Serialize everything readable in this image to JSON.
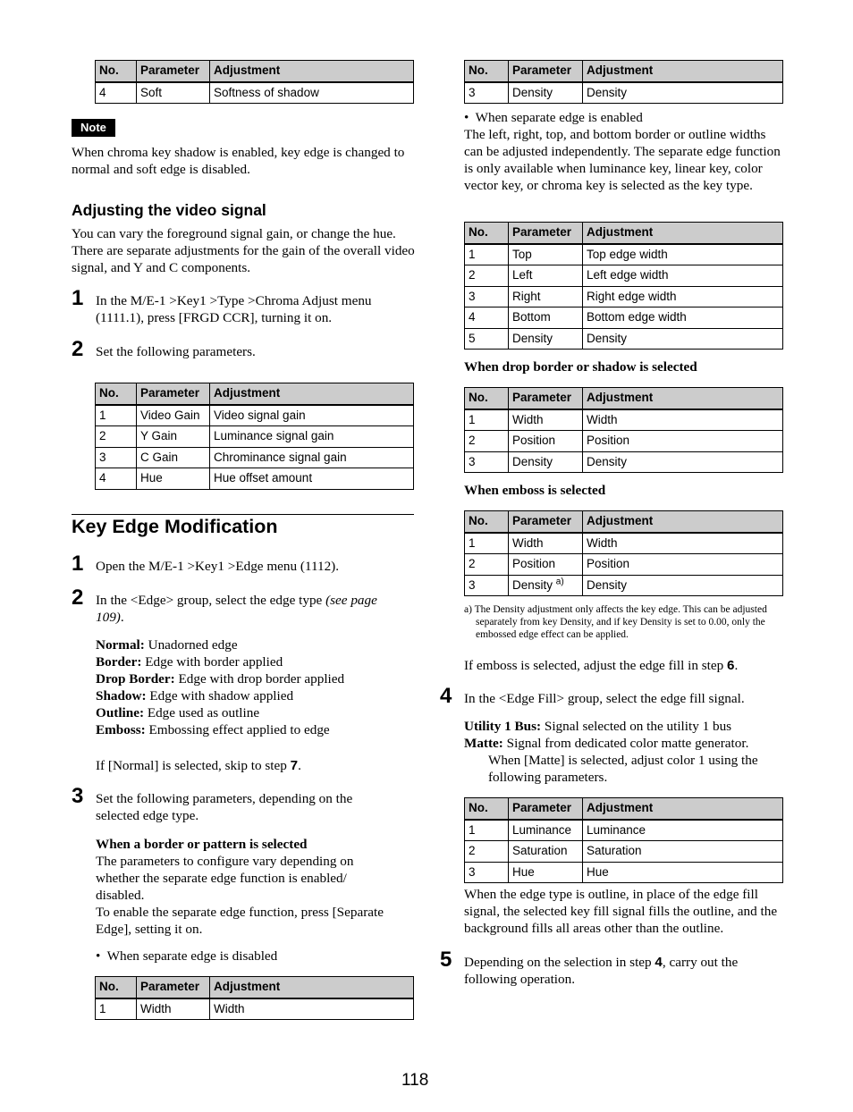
{
  "table_header": {
    "no": "No.",
    "parameter": "Parameter",
    "adjustment": "Adjustment"
  },
  "left": {
    "shadow_table": [
      {
        "no": "4",
        "parameter": "Soft",
        "adjustment": "Softness of shadow"
      }
    ],
    "note_label": "Note",
    "note_text": "When chroma key shadow is enabled, key edge is changed to normal and soft edge is disabled.",
    "video_signal": {
      "heading": "Adjusting the video signal",
      "intro": "You can vary the foreground signal gain, or change the hue. There are separate adjustments for the gain of the overall video signal, and Y and C components.",
      "step1_num": "1",
      "step1_text": "In the M/E-1 >Key1 >Type >Chroma Adjust menu (1111.1), press [FRGD CCR], turning it on.",
      "step2_num": "2",
      "step2_text": "Set the following parameters.",
      "table": [
        {
          "no": "1",
          "parameter": "Video Gain",
          "adjustment": "Video signal gain"
        },
        {
          "no": "2",
          "parameter": "Y Gain",
          "adjustment": "Luminance signal gain"
        },
        {
          "no": "3",
          "parameter": "C Gain",
          "adjustment": "Chrominance signal gain"
        },
        {
          "no": "4",
          "parameter": "Hue",
          "adjustment": "Hue offset amount"
        }
      ]
    },
    "key_edge": {
      "title": "Key Edge Modification",
      "step1_num": "1",
      "step1_text": "Open the M/E-1 >Key1 >Edge menu (1112).",
      "step2_num": "2",
      "step2_text_a": "In the <Edge> group, select the edge type ",
      "step2_text_ref": "(see page 109)",
      "step2_text_b": ".",
      "edge_types": [
        {
          "term": "Normal:",
          "desc": " Unadorned edge"
        },
        {
          "term": "Border:",
          "desc": " Edge with border applied"
        },
        {
          "term": "Drop Border:",
          "desc": " Edge with drop border applied"
        },
        {
          "term": "Shadow:",
          "desc": " Edge with shadow applied"
        },
        {
          "term": "Outline:",
          "desc": " Edge used as outline"
        },
        {
          "term": "Emboss:",
          "desc": " Embossing effect applied to edge"
        }
      ],
      "skip_text_a": "If [Normal] is selected, skip to step ",
      "skip_step": "7",
      "skip_text_b": ".",
      "step3_num": "3",
      "step3_text": "Set the following parameters, depending on the selected edge type.",
      "border_heading": "When a border or pattern is selected",
      "border_text1": "The parameters to configure vary depending on whether the separate edge function is enabled/ disabled.",
      "border_text2": "To enable the separate edge function, press [Separate Edge], setting it on.",
      "bullet_disabled": "When separate edge is disabled",
      "disabled_table": [
        {
          "no": "1",
          "parameter": "Width",
          "adjustment": "Width"
        }
      ]
    }
  },
  "right": {
    "density_table": [
      {
        "no": "3",
        "parameter": "Density",
        "adjustment": "Density"
      }
    ],
    "bullet_enabled": "When separate edge is enabled",
    "enabled_text": "The left, right, top, and bottom border or outline widths can be adjusted independently. The separate edge function is only available when luminance key, linear key, color vector key, or chroma key is selected as the key type.",
    "enabled_table": [
      {
        "no": "1",
        "parameter": "Top",
        "adjustment": "Top edge width"
      },
      {
        "no": "2",
        "parameter": "Left",
        "adjustment": "Left edge width"
      },
      {
        "no": "3",
        "parameter": "Right",
        "adjustment": "Right edge width"
      },
      {
        "no": "4",
        "parameter": "Bottom",
        "adjustment": "Bottom edge width"
      },
      {
        "no": "5",
        "parameter": "Density",
        "adjustment": "Density"
      }
    ],
    "drop_heading": "When drop border or shadow is selected",
    "drop_table": [
      {
        "no": "1",
        "parameter": "Width",
        "adjustment": "Width"
      },
      {
        "no": "2",
        "parameter": "Position",
        "adjustment": "Position"
      },
      {
        "no": "3",
        "parameter": "Density",
        "adjustment": "Density"
      }
    ],
    "emboss_heading": "When emboss is selected",
    "emboss_table": [
      {
        "no": "1",
        "parameter": "Width",
        "adjustment": "Width"
      },
      {
        "no": "2",
        "parameter": "Position",
        "adjustment": "Position"
      },
      {
        "no": "3",
        "parameter": "Density",
        "sup": "a)",
        "adjustment": "Density"
      }
    ],
    "footnote": "a) The Density adjustment only affects the key edge. This can be adjusted separately from key Density, and if key Density is set to 0.00, only the embossed edge effect can be applied.",
    "emboss_note_a": "If emboss is selected, adjust the edge fill in step ",
    "emboss_note_step": "6",
    "emboss_note_b": ".",
    "step4_num": "4",
    "step4_text": "In the <Edge Fill> group, select the edge fill signal.",
    "fill_options": [
      {
        "term": "Utility 1 Bus:",
        "desc": " Signal selected on the utility 1 bus"
      },
      {
        "term": "Matte:",
        "desc": " Signal from dedicated color matte generator."
      }
    ],
    "matte_detail": "When [Matte] is selected, adjust color 1 using the following parameters.",
    "matte_table": [
      {
        "no": "1",
        "parameter": "Luminance",
        "adjustment": "Luminance"
      },
      {
        "no": "2",
        "parameter": "Saturation",
        "adjustment": "Saturation"
      },
      {
        "no": "3",
        "parameter": "Hue",
        "adjustment": "Hue"
      }
    ],
    "outline_text": "When the edge type is outline, in place of the edge fill signal, the selected key fill signal fills the outline, and the background fills all areas other than the outline.",
    "step5_num": "5",
    "step5_text_a": "Depending on the selection in step ",
    "step5_step": "4",
    "step5_text_b": ", carry out the following operation."
  },
  "page_number": "118"
}
